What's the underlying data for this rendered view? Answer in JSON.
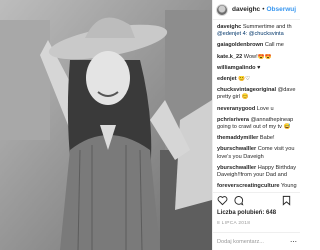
{
  "post": {
    "username": "daveighc",
    "separator": "•",
    "follow_label": "Obserwuj",
    "likes_label": "Liczba polubień:",
    "likes_count": "648",
    "date": "8 LIPCA 2018",
    "add_comment_placeholder": "Dodaj komentarz..."
  },
  "comments": [
    {
      "user": "daveighc",
      "text": "Summertime and th",
      "line2": "@edenjet 4: @chucksvinta"
    },
    {
      "user": "gaiagoldenbrown",
      "text": "Call me",
      "line2": ""
    },
    {
      "user": "kate.k_22",
      "text": "Wow!😍😍",
      "line2": ""
    },
    {
      "user": "williamgalindo",
      "text": "♥",
      "line2": ""
    },
    {
      "user": "edenjet",
      "text": "😊♡",
      "line2": ""
    },
    {
      "user": "chucksvintageoriginal",
      "text": "@dave",
      "line2": "pretty girl 😊"
    },
    {
      "user": "neveranygood",
      "text": "Love u",
      "line2": ""
    },
    {
      "user": "pchrisrivera",
      "text": "@annathepineap",
      "line2": "going to crawl out of my tv 😅"
    },
    {
      "user": "themaddymiller",
      "text": "Babe!",
      "line2": ""
    },
    {
      "user": "yburschwalller",
      "text": "Come visit you",
      "line2": "love's you Daveigh"
    },
    {
      "user": "yburschwalller",
      "text": "Happy Birthday",
      "line2": "Daveigh!!from your Dad and"
    },
    {
      "user": "foreverscreatingculture",
      "text": "Young",
      "line2": ""
    }
  ],
  "icons": {
    "like": "heart-icon",
    "comment": "comment-icon",
    "share": "share-icon",
    "save": "bookmark-icon",
    "more": "more-dots-icon"
  }
}
